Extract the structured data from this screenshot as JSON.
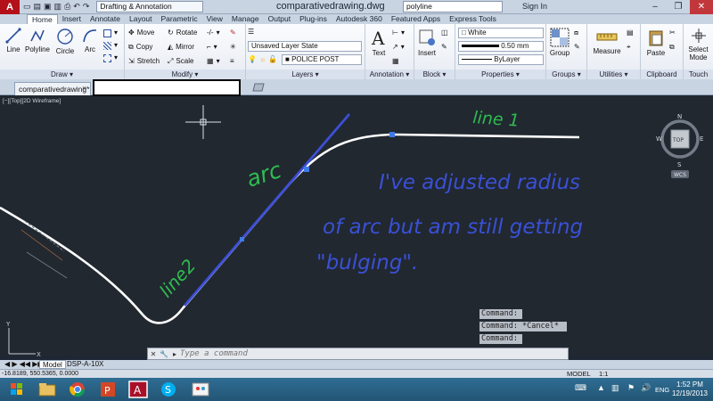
{
  "window": {
    "workspace": "Drafting & Annotation",
    "doc_title": "comparativedrawing.dwg",
    "search_value": "polyline",
    "sign_in": "Sign In",
    "app_letter": "A"
  },
  "ribbon_tabs": [
    "Home",
    "Insert",
    "Annotate",
    "Layout",
    "Parametric",
    "View",
    "Manage",
    "Output",
    "Plug-ins",
    "Autodesk 360",
    "Featured Apps",
    "Express Tools"
  ],
  "draw_panel": {
    "title": "Draw ▾",
    "line": "Line",
    "polyline": "Polyline",
    "circle": "Circle",
    "arc": "Arc"
  },
  "modify_panel": {
    "title": "Modify ▾",
    "move": "Move",
    "rotate": "Rotate",
    "copy": "Copy",
    "mirror": "Mirror",
    "stretch": "Stretch",
    "scale": "Scale"
  },
  "layers_panel": {
    "title": "Layers ▾",
    "layer_state": "Unsaved Layer State",
    "current_layer": "POLICE POST"
  },
  "annotation_panel": {
    "title": "Annotation ▾",
    "text": "Text"
  },
  "block_panel": {
    "title": "Block ▾",
    "insert": "Insert"
  },
  "properties_panel": {
    "title": "Properties ▾",
    "color": "White",
    "lineweight": "0.50 mm",
    "linetype": "ByLayer"
  },
  "groups_panel": {
    "title": "Groups ▾",
    "group": "Group"
  },
  "utilities_panel": {
    "title": "Utilities ▾",
    "measure": "Measure"
  },
  "clipboard_panel": {
    "title": "Clipboard",
    "paste": "Paste"
  },
  "touch_panel": {
    "title": "Touch",
    "select_mode_1": "Select",
    "select_mode_2": "Mode"
  },
  "file_tab": {
    "label": "comparativedrawing*",
    "close": "×"
  },
  "viewport_label": "[−][Top][2D Wireframe]",
  "viewcube": {
    "n": "N",
    "s": "S",
    "e": "E",
    "w": "W",
    "face": "TOP",
    "wcs": "WCS"
  },
  "annotations": {
    "line1": "line 1",
    "arc": "arc",
    "line2": "line2",
    "note_1": "I've adjusted radius",
    "note_2": "of arc but am still getting",
    "note_3": "\"bulging\"."
  },
  "command_history": [
    "Command:",
    "Command: *Cancel*",
    "Command:"
  ],
  "command_placeholder": "Type a command",
  "layout_tabs": [
    "Model",
    "DSP-A-10X"
  ],
  "status": {
    "coords": "-16.8189, 550.5365, 0.0000",
    "model": "MODEL",
    "scale": "1:1"
  },
  "tray": {
    "lang": "ENG",
    "time": "1:52 PM",
    "date": "12/19/2013"
  },
  "colors": {
    "canvas": "#212830",
    "polyline": "#ffffff",
    "marker_blue": "#3d4fd8",
    "marker_green": "#2fbb4f",
    "grip": "#3f7be8"
  }
}
